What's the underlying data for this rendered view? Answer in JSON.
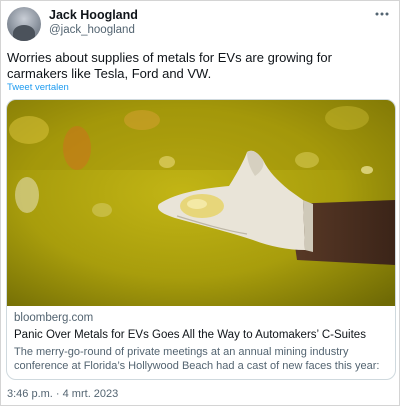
{
  "tweet": {
    "author_name": "Jack Hoogland",
    "author_handle": "@jack_hoogland",
    "more_icon": "more-horizontal-icon",
    "text": "Worries about supplies of metals for EVs are growing for carmakers like Tesla, Ford and VW.",
    "translate_label": "Tweet vertalen",
    "timestamp": "3:46 p.m. · 4 mrt. 2023"
  },
  "link_card": {
    "domain": "bloomberg.com",
    "title": "Panic Over Metals for EVs Goes All the Way to Automakers’ C-Suites",
    "description": "The merry-go-round of private meetings at an annual mining industry conference at Florida’s Hollywood Beach had a cast of new faces this year: ..."
  },
  "colors": {
    "link_blue": "#1d9bf0",
    "secondary_text": "#536471",
    "primary_text": "#0f1419",
    "border": "#cfd9de"
  }
}
